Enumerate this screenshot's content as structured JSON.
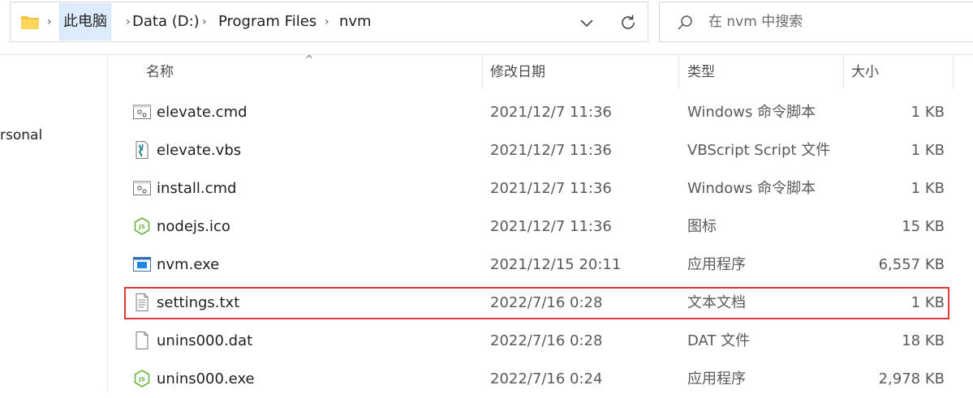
{
  "address": {
    "crumbs": [
      "此电脑",
      "Data (D:)",
      "Program Files",
      "nvm"
    ]
  },
  "search": {
    "placeholder": "在 nvm 中搜索"
  },
  "nav": {
    "partial_item": "rsonal"
  },
  "columns": {
    "name": "名称",
    "date": "修改日期",
    "type": "类型",
    "size": "大小"
  },
  "files": [
    {
      "name": "elevate.cmd",
      "date": "2021/12/7 11:36",
      "type": "Windows 命令脚本",
      "size": "1 KB",
      "icon": "cmd-script-icon"
    },
    {
      "name": "elevate.vbs",
      "date": "2021/12/7 11:36",
      "type": "VBScript Script 文件",
      "size": "1 KB",
      "icon": "vbs-script-icon"
    },
    {
      "name": "install.cmd",
      "date": "2021/12/7 11:36",
      "type": "Windows 命令脚本",
      "size": "1 KB",
      "icon": "cmd-script-icon"
    },
    {
      "name": "nodejs.ico",
      "date": "2021/12/7 11:36",
      "type": "图标",
      "size": "15 KB",
      "icon": "nodejs-icon"
    },
    {
      "name": "nvm.exe",
      "date": "2021/12/15 20:11",
      "type": "应用程序",
      "size": "6,557 KB",
      "icon": "exe-app-icon"
    },
    {
      "name": "settings.txt",
      "date": "2022/7/16 0:28",
      "type": "文本文档",
      "size": "1 KB",
      "icon": "text-file-icon"
    },
    {
      "name": "unins000.dat",
      "date": "2022/7/16 0:28",
      "type": "DAT 文件",
      "size": "18 KB",
      "icon": "blank-file-icon"
    },
    {
      "name": "unins000.exe",
      "date": "2022/7/16 0:24",
      "type": "应用程序",
      "size": "2,978 KB",
      "icon": "nodejs-icon"
    }
  ],
  "highlight": {
    "row": "settings.txt",
    "color": "#e0353b"
  }
}
